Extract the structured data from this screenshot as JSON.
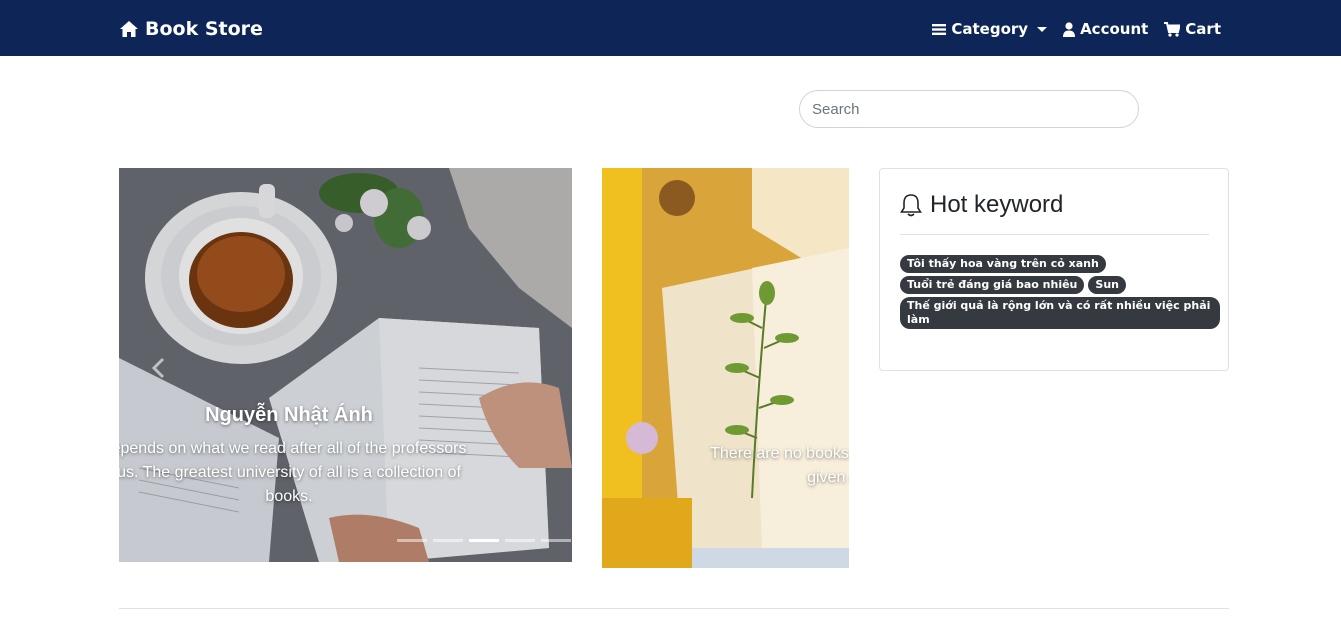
{
  "navbar": {
    "brand": "Book Store",
    "brand_icon": "home-icon",
    "category_label": "Category",
    "account_label": "Account",
    "cart_label": "Cart",
    "background": "#0d2557"
  },
  "search": {
    "placeholder": "Search"
  },
  "carousel_main": {
    "caption_title": "Nguyễn Nhật Ánh",
    "caption_text": "epends on what we read after all of the professors us. The greatest university of all is a collection of books.",
    "indicator_count": 5,
    "active_indicator": 3
  },
  "carousel_side": {
    "caption_text": "There are no books books that a person given circum"
  },
  "hot_keyword": {
    "title": "Hot keyword",
    "tags": [
      "Tôi thấy hoa vàng trên cỏ xanh",
      "Tuổi trẻ đáng giá bao nhiêu",
      "Sun",
      "Thế giới quả là rộng lớn và có rất nhiều việc phải làm"
    ]
  }
}
